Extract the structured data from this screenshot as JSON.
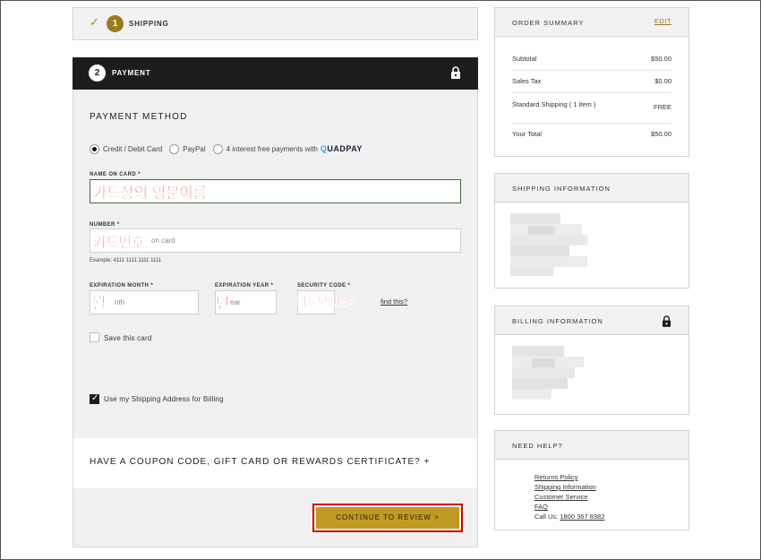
{
  "shipping_step": {
    "number": "1",
    "label": "SHIPPING",
    "check_icon": "check-icon"
  },
  "payment_step": {
    "number": "2",
    "label": "PAYMENT"
  },
  "payment_method": {
    "title": "PAYMENT METHOD",
    "options": [
      {
        "label": "Credit / Debit Card",
        "selected": true
      },
      {
        "label": "PayPal",
        "selected": false
      },
      {
        "label": "4 interest free payments with",
        "selected": false
      }
    ],
    "quadpay_brand": "UADPAY",
    "quadpay_brand_q": "Q"
  },
  "fields": {
    "name_label": "NAME ON CARD *",
    "name_overlay": "카드상의 영문이름",
    "number_label": "NUMBER *",
    "number_placeholder": "on card",
    "number_overlay": "카드번호",
    "example": "Example: 4111 1111 1111 1111",
    "month_label": "EXPIRATION MONTH *",
    "month_placeholder": "nth",
    "month_overlay": "월",
    "year_label": "EXPIRATION YEAR *",
    "year_placeholder": "ear",
    "year_overlay": "년",
    "cvv_label": "SECURITY CODE *",
    "cvv_overlay": "카드보안넘버",
    "find_link": "find this?"
  },
  "save_card": {
    "label": "Save this card",
    "checked": false
  },
  "use_shipping": {
    "label": "Use my Shipping Address for Billing",
    "checked": true
  },
  "coupon": {
    "label": "HAVE A COUPON CODE, GIFT CARD OR REWARDS CERTIFICATE? +"
  },
  "cta": {
    "label": "CONTINUE TO REVIEW >"
  },
  "order_summary": {
    "title": "ORDER SUMMARY",
    "edit": "EDIT",
    "rows": [
      {
        "label": "Subtotal",
        "value": "$50.00"
      },
      {
        "label": "Sales Tax",
        "value": "$0.00"
      },
      {
        "label": "Standard Shipping ( 1 item )",
        "value": "FREE"
      },
      {
        "label": "Your Total",
        "value": "$50.00"
      }
    ]
  },
  "shipping_info": {
    "title": "SHIPPING INFORMATION"
  },
  "billing_info": {
    "title": "BILLING INFORMATION"
  },
  "need_help": {
    "title": "NEED HELP?",
    "links": [
      "Returns Policy",
      "Shipping Information",
      "Customer Service",
      "FAQ"
    ],
    "call_prefix": "Call Us: ",
    "phone": "1800 367 8382"
  },
  "colors": {
    "gold": "#c09a22",
    "dark_gold": "#9c7b22",
    "header_dark": "#1d1d1d",
    "highlight_red": "#d40000"
  }
}
